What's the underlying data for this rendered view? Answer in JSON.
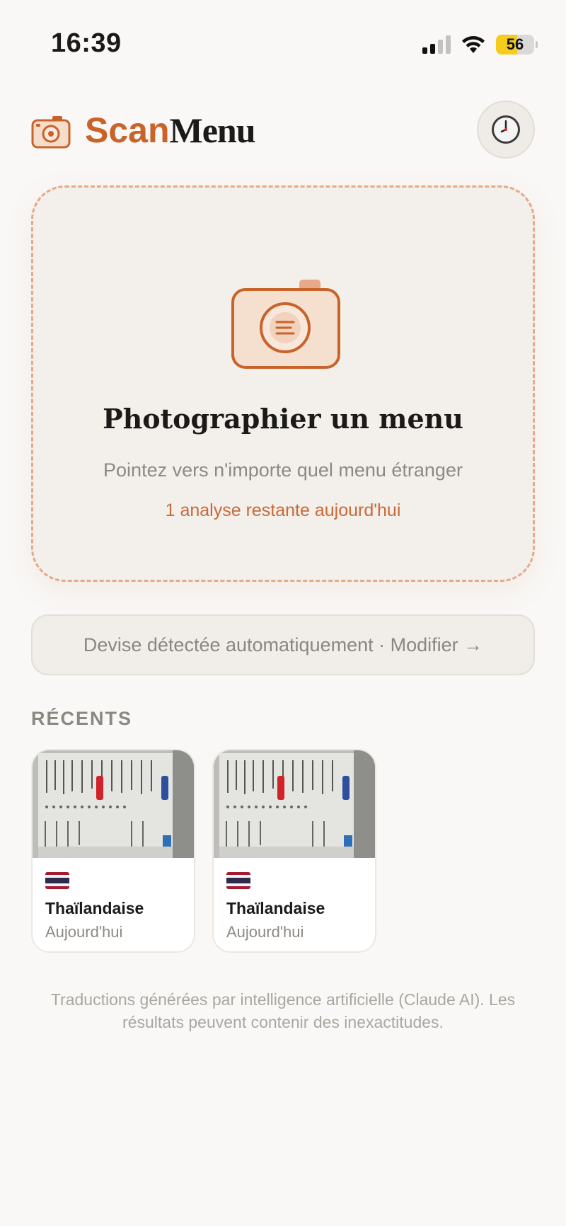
{
  "status_bar": {
    "time": "16:39",
    "battery": "56"
  },
  "header": {
    "brand_part1": "Scan",
    "brand_part2": "Menu",
    "history_icon": "clock-icon"
  },
  "scan_card": {
    "title": "Photographier un menu",
    "subtitle": "Pointez vers n'importe quel menu étranger",
    "remaining": "1 analyse restante aujourd'hui"
  },
  "currency": {
    "label": "Devise détectée automatiquement · Modifier →"
  },
  "recents": {
    "title": "RÉCENTS",
    "items": [
      {
        "cuisine": "Thaïlandaise",
        "date": "Aujourd'hui",
        "flag": "thailand-flag"
      },
      {
        "cuisine": "Thaïlandaise",
        "date": "Aujourd'hui",
        "flag": "thailand-flag"
      }
    ]
  },
  "disclaimer": "Traductions générées par intelligence artificielle (Claude AI). Les résultats peuvent contenir des inexactitudes.",
  "colors": {
    "accent": "#c8632a",
    "background": "#f9f8f6",
    "card": "#f3efea"
  }
}
